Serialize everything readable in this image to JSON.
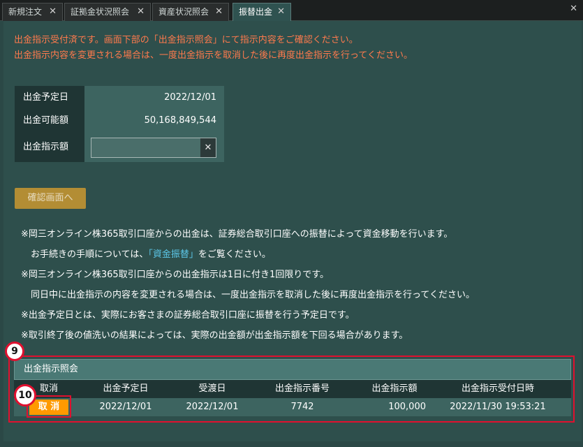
{
  "tabs": [
    {
      "label": "新規注文",
      "active": false
    },
    {
      "label": "証拠金状況照会",
      "active": false
    },
    {
      "label": "資産状況照会",
      "active": false
    },
    {
      "label": "振替出金",
      "active": true
    }
  ],
  "icons": {
    "tab_close": "✕",
    "window_close": "✕",
    "clear": "✕"
  },
  "notice": {
    "line1": "出金指示受付済です。画面下部の「出金指示照会」にて指示内容をご確認ください。",
    "line2": "出金指示内容を変更される場合は、一度出金指示を取消した後に再度出金指示を行ってください。"
  },
  "form": {
    "scheduled_date_label": "出金予定日",
    "scheduled_date_value": "2022/12/01",
    "available_label": "出金可能額",
    "available_value": "50,168,849,544",
    "amount_label": "出金指示額",
    "amount_value": "",
    "confirm_label": "確認画面へ"
  },
  "notes": {
    "n1": "※岡三オンライン株365取引口座からの出金は、証券総合取引口座への振替によって資金移動を行います。",
    "n2_pre": "お手続きの手順については、",
    "n2_link": "「資金振替」",
    "n2_post": "をご覧ください。",
    "n3": "※岡三オンライン株365取引口座からの出金指示は1日に付き1回限りです。",
    "n4": "同日中に出金指示の内容を変更される場合は、一度出金指示を取消した後に再度出金指示を行ってください。",
    "n5": "※出金予定日とは、実際にお客さまの証券総合取引口座に振替を行う予定日です。",
    "n6": "※取引終了後の値洗いの結果によっては、実際の出金額が出金指示額を下回る場合があります。"
  },
  "inquiry": {
    "title": "出金指示照会",
    "columns": [
      "取消",
      "出金予定日",
      "受渡日",
      "出金指示番号",
      "出金指示額",
      "出金指示受付日時"
    ],
    "row": {
      "cancel_label": "取 消",
      "scheduled_date": "2022/12/01",
      "delivery_date": "2022/12/01",
      "instruction_no": "7742",
      "amount": "100,000",
      "received_at": "2022/11/30 19:53:21"
    }
  },
  "markers": {
    "m9": "9",
    "m10": "10"
  },
  "colors": {
    "notice": "#ff7a4d",
    "highlight": "#e0102f",
    "cancel": "#ff9a00",
    "link": "#5cc7e8"
  }
}
